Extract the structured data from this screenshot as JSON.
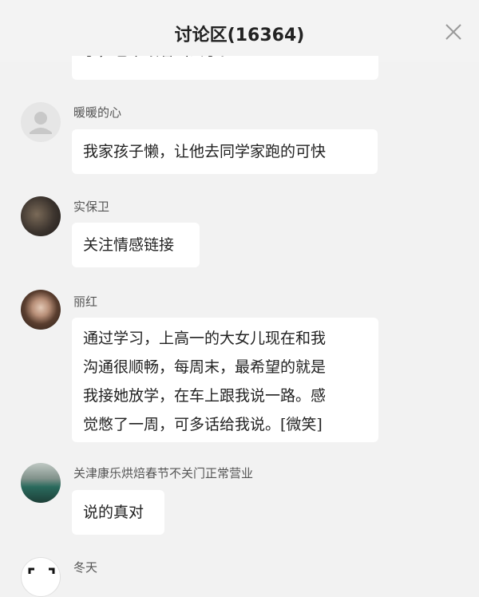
{
  "header": {
    "title": "讨论区(16364)"
  },
  "partial_comment": {
    "text": "了，也不跟着出去了。"
  },
  "comments": [
    {
      "author": "暖暖的心",
      "text": "我家孩子懒，让他去同学家跑的可快"
    },
    {
      "author": "实保卫",
      "text": "关注情感链接"
    },
    {
      "author": "丽红",
      "lines": [
        "通过学习，上高一的大女儿现在和我",
        "沟通很顺畅，每周末，最希望的就是",
        "我接她放学，在车上跟我说一路。感",
        "觉憋了一周，可多话给我说。[微笑]"
      ]
    },
    {
      "author": "关津康乐烘焙春节不关门正常营业",
      "text": "说的真对"
    },
    {
      "author": "冬天"
    }
  ],
  "icons": {
    "close": "close-icon",
    "default_avatar": "default-avatar-icon"
  },
  "colors": {
    "background": "#f2f2f2",
    "bubble": "#ffffff",
    "text": "#222222",
    "name": "#555555"
  }
}
